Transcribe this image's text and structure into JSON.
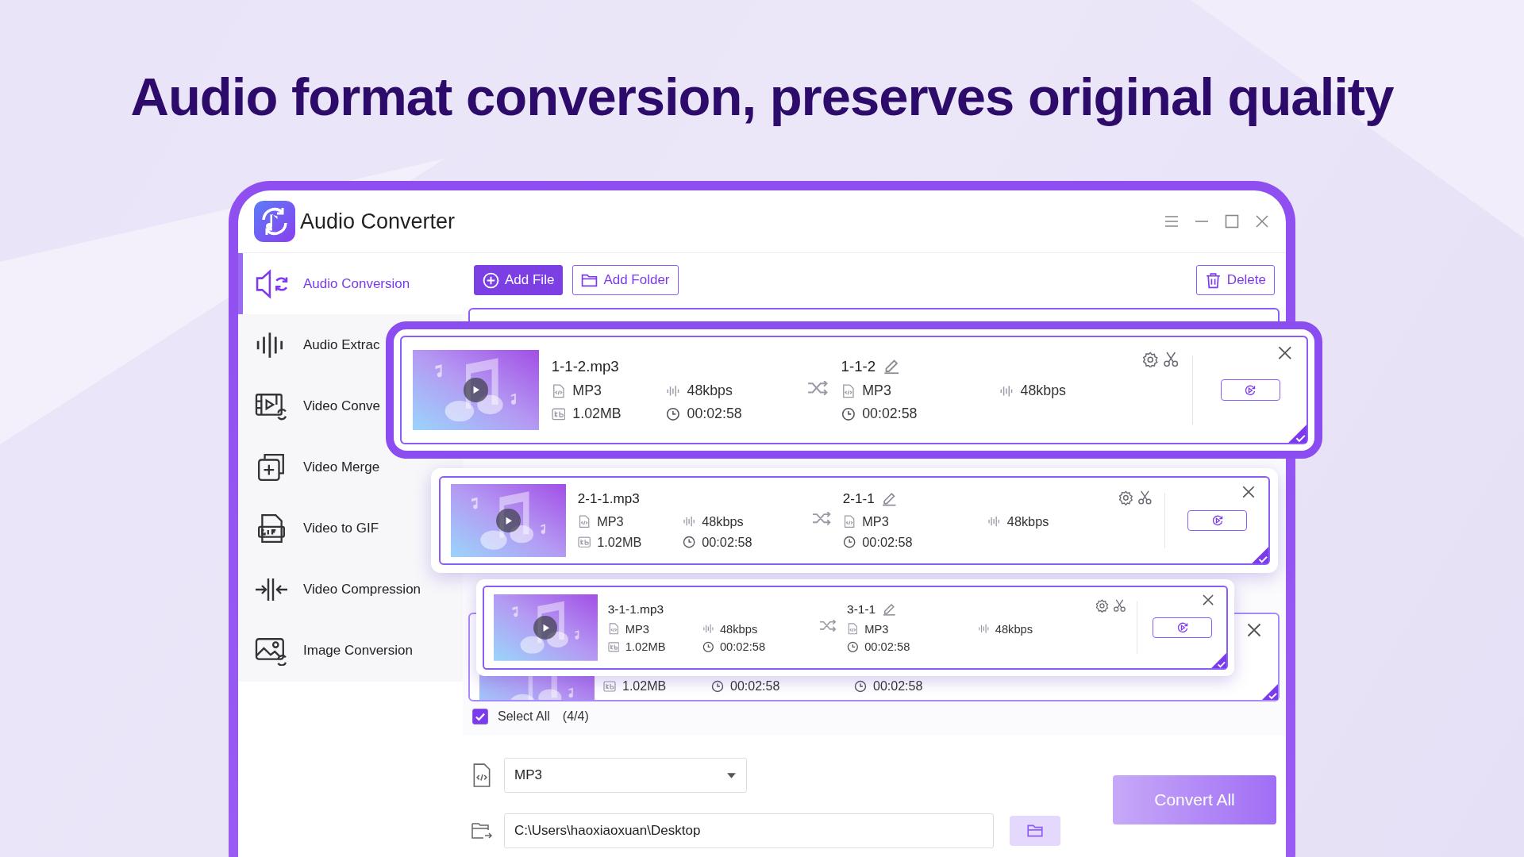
{
  "headline": "Audio format conversion, preserves original quality",
  "window": {
    "title": "Audio Converter"
  },
  "sidebar": {
    "items": [
      {
        "label": "Audio Conversion",
        "kind": "audio-conversion",
        "selected": true
      },
      {
        "label": "Audio Extrac",
        "kind": "audio-extraction",
        "selected": false
      },
      {
        "label": "Video Conve",
        "kind": "video-conversion",
        "selected": false
      },
      {
        "label": "Video Merge",
        "kind": "video-merge",
        "selected": false
      },
      {
        "label": "Video to GIF",
        "kind": "video-gif",
        "selected": false
      },
      {
        "label": "Video Compression",
        "kind": "video-compression",
        "selected": false
      },
      {
        "label": "Image Conversion",
        "kind": "image-conversion",
        "selected": false
      }
    ]
  },
  "toolbar": {
    "buttons": [
      {
        "label": "Add File",
        "kind": "add-file"
      },
      {
        "label": "Add Folder",
        "kind": "add-folder"
      },
      {
        "label": "Delete",
        "kind": "delete"
      }
    ]
  },
  "files": [
    {
      "name": "1-1-2.mp3",
      "output_name": "1-1-2",
      "input": {
        "format": "MP3",
        "bitrate": "48kbps",
        "size": "1.02MB",
        "duration": "00:02:58"
      },
      "output": {
        "format": "MP3",
        "bitrate": "48kbps",
        "duration": "00:02:58"
      },
      "checked": true
    },
    {
      "name": "2-1-1.mp3",
      "output_name": "2-1-1",
      "input": {
        "format": "MP3",
        "bitrate": "48kbps",
        "size": "1.02MB",
        "duration": "00:02:58"
      },
      "output": {
        "format": "MP3",
        "bitrate": "48kbps",
        "duration": "00:02:58"
      },
      "checked": true
    },
    {
      "name": "3-1-1.mp3",
      "output_name": "3-1-1",
      "input": {
        "format": "MP3",
        "bitrate": "48kbps",
        "size": "1.02MB",
        "duration": "00:02:58"
      },
      "output": {
        "format": "MP3",
        "bitrate": "48kbps",
        "duration": "00:02:58"
      },
      "checked": true
    }
  ],
  "hidden_file": {
    "size": "1.02MB",
    "duration": "00:02:58",
    "output_duration": "00:02:58",
    "checked": true
  },
  "select_all": {
    "label": "Select All",
    "count": "(4/4)",
    "checked": true
  },
  "output": {
    "format": "MP3",
    "path": "C:\\Users\\haoxiaoxuan\\Desktop"
  },
  "convert_button": "Convert All"
}
